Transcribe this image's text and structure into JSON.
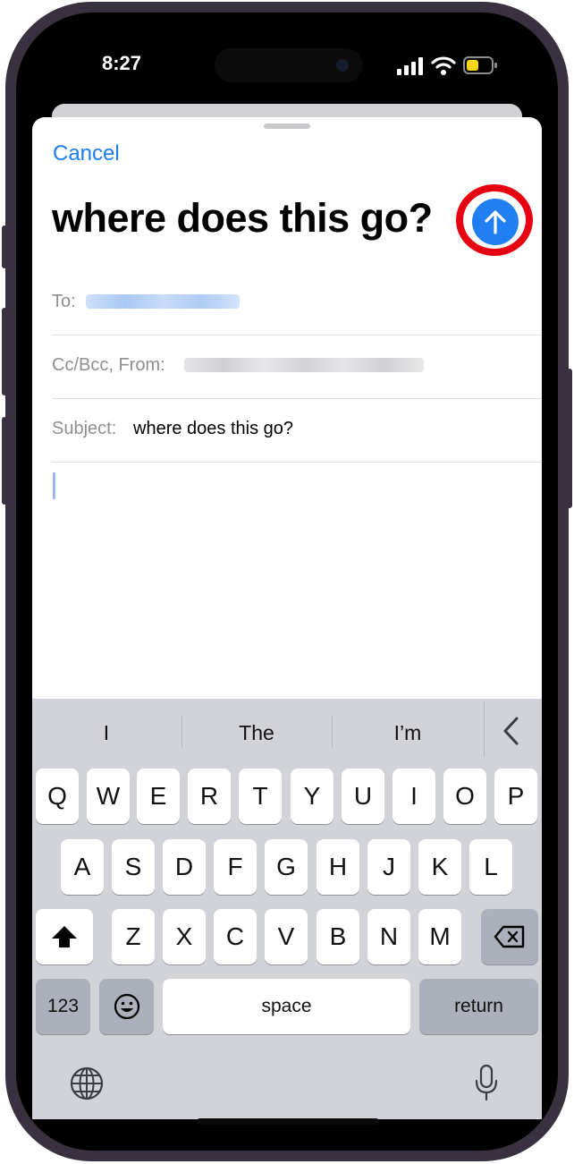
{
  "status": {
    "time": "8:27"
  },
  "compose": {
    "cancel_label": "Cancel",
    "title": "where does this go?",
    "to_label": "To:",
    "ccbcc_label": "Cc/Bcc, From:",
    "subject_label": "Subject:",
    "subject_value": "where does this go?"
  },
  "suggestions": [
    "I",
    "The",
    "I’m"
  ],
  "keyboard": {
    "row1": [
      "Q",
      "W",
      "E",
      "R",
      "T",
      "Y",
      "U",
      "I",
      "O",
      "P"
    ],
    "row2": [
      "A",
      "S",
      "D",
      "F",
      "G",
      "H",
      "J",
      "K",
      "L"
    ],
    "row3": [
      "Z",
      "X",
      "C",
      "V",
      "B",
      "N",
      "M"
    ],
    "numbers_label": "123",
    "space_label": "space",
    "return_label": "return"
  },
  "colors": {
    "accent": "#1f7ff3",
    "highlight_ring": "#e60012",
    "keyboard_bg": "#d1d3d9"
  }
}
